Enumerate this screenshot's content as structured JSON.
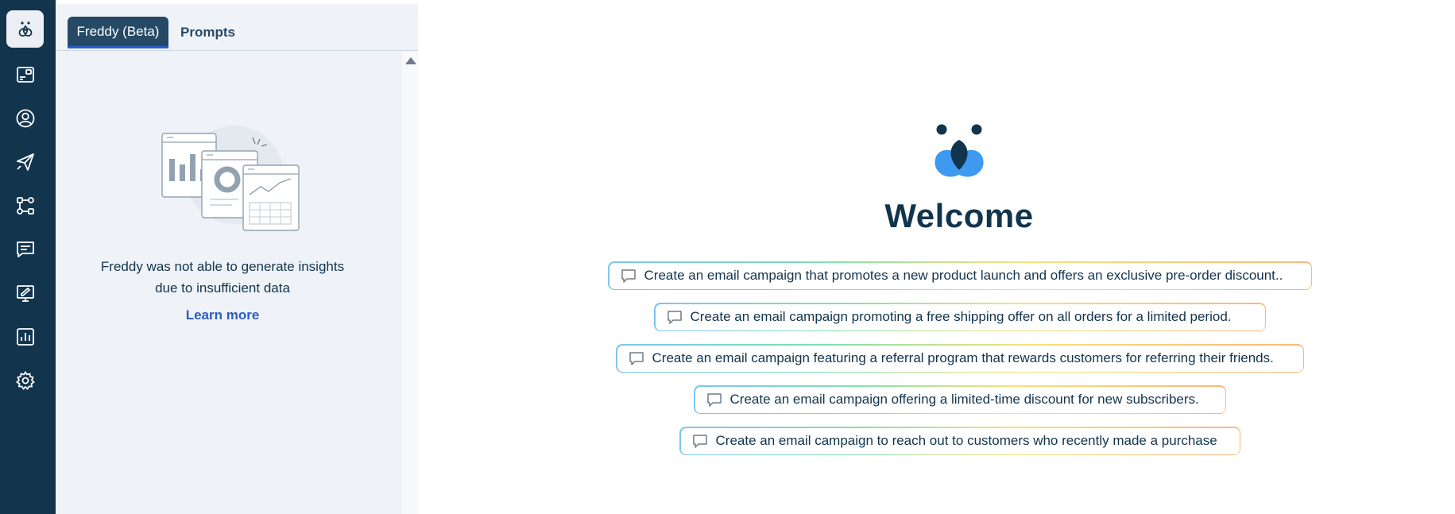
{
  "sidebar": {
    "items": [
      {
        "icon": "freddy-ai-icon",
        "active": true
      },
      {
        "icon": "dashboard-icon",
        "active": false
      },
      {
        "icon": "contacts-icon",
        "active": false
      },
      {
        "icon": "campaigns-icon",
        "active": false
      },
      {
        "icon": "journeys-icon",
        "active": false
      },
      {
        "icon": "messages-icon",
        "active": false
      },
      {
        "icon": "content-editor-icon",
        "active": false
      },
      {
        "icon": "analytics-icon",
        "active": false
      },
      {
        "icon": "settings-icon",
        "active": false
      }
    ]
  },
  "panel": {
    "tabs": [
      "Freddy (Beta)",
      "Prompts"
    ],
    "empty_message": "Freddy was not able to generate insights due to insufficient data",
    "learn_more": "Learn more"
  },
  "main": {
    "welcome": "Welcome",
    "prompts": [
      "Create an email campaign that promotes a new product launch and offers an exclusive pre-order discount..",
      "Create an email campaign promoting a free shipping offer on all orders for a limited period.",
      "Create an email campaign featuring a referral program that rewards customers for referring their friends.",
      "Create an email campaign offering a limited-time discount for new subscribers.",
      "Create an email campaign to reach out to customers who recently made a purchase"
    ]
  },
  "colors": {
    "rail": "#12344d",
    "panel_bg": "#eff3f8",
    "accent": "#2c5cc5",
    "logo_blue": "#3e99f0"
  }
}
